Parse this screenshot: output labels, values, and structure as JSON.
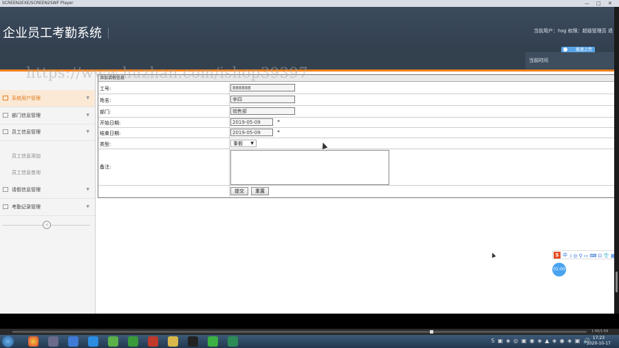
{
  "window": {
    "title": "SCREEN2EXE/SCREEN2SWF Player",
    "minimize": "—",
    "maximize": "□",
    "close": "✕"
  },
  "header": {
    "system_title": "企业员工考勤系统",
    "user_info": "当前用户：hsg  权限：超级管理员  退",
    "current_time_label": "当前时间",
    "badge_label": "极速上传"
  },
  "watermark": "https://www.huzhan.com/ishop39397",
  "sidebar": {
    "items": [
      {
        "label": "系统用户管理",
        "active": true
      },
      {
        "label": "部门信息管理",
        "active": false
      },
      {
        "label": "员工信息管理",
        "active": false
      },
      {
        "label": "员工信息添加",
        "sub": true
      },
      {
        "label": "员工信息查询",
        "sub": true
      },
      {
        "label": "请假信息管理",
        "active": false
      },
      {
        "label": "考勤记录管理",
        "active": false
      }
    ],
    "collapse_icon": "‹"
  },
  "form": {
    "header": "添加请假信息",
    "fields": {
      "employee_id": {
        "label": "工号:",
        "value": "888888"
      },
      "name": {
        "label": "姓名:",
        "value": "李四"
      },
      "department": {
        "label": "部门:",
        "value": "销售部"
      },
      "start_date": {
        "label": "开始日期:",
        "value": "2019-05-09",
        "required": "*"
      },
      "end_date": {
        "label": "结束日期:",
        "value": "2019-05-09",
        "required": "*"
      },
      "type": {
        "label": "类型:",
        "value": "事假"
      },
      "remarks": {
        "label": "备注:",
        "value": ""
      }
    },
    "submit_label": "提交",
    "reset_label": "重置"
  },
  "floating": {
    "ime_logo": "S",
    "ime_lang": "中",
    "ime_tools": "ｼ◎⚲▭⌨⊡👕▦",
    "recorder_time": "01:00"
  },
  "player": {
    "time": "1:56/1:59"
  },
  "taskbar": {
    "tray": "S ▣ ◈ ◎ ▣ ◉ ◈ ▲ ◈ ◉ ◈ ▣ 🔊",
    "time": "17:23",
    "date": "2020-10-17"
  }
}
